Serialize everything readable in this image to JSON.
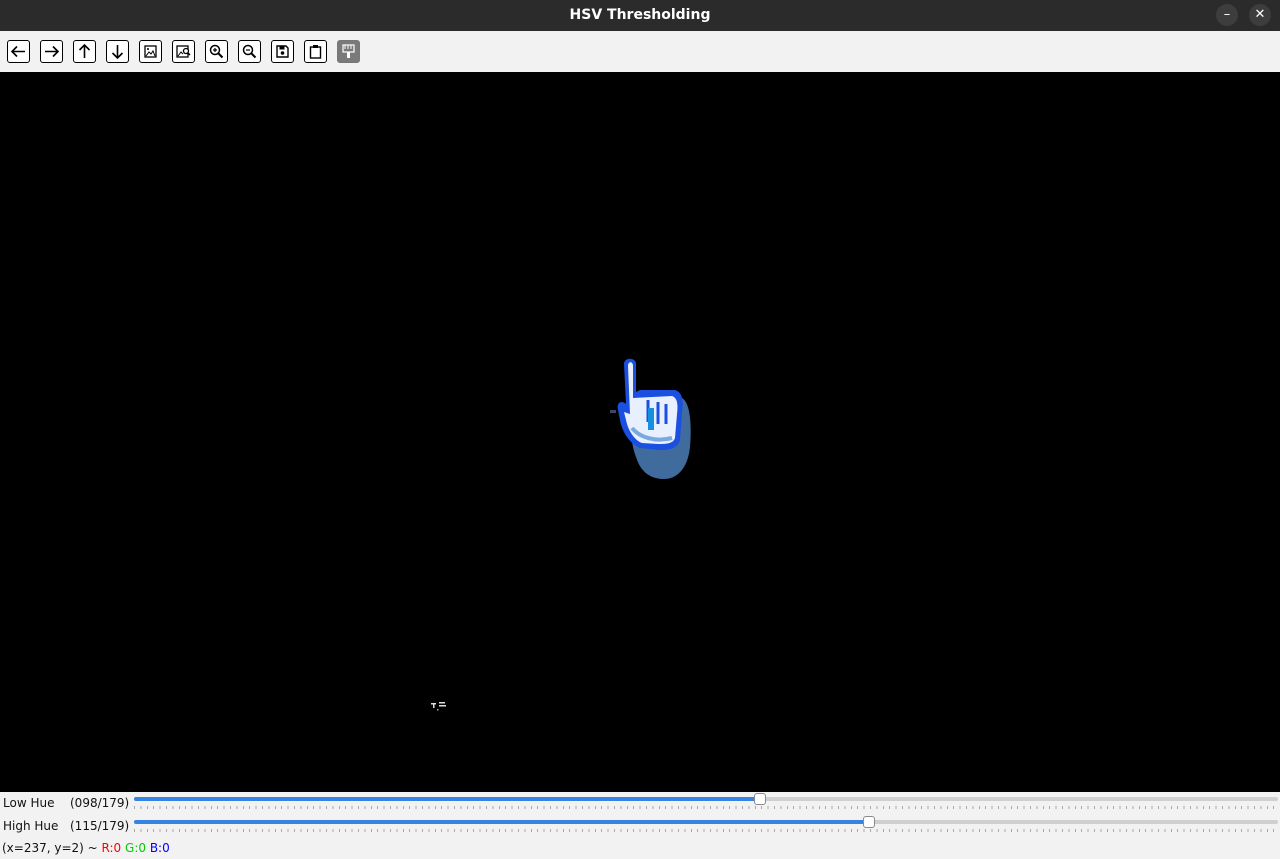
{
  "window": {
    "title": "HSV Thresholding",
    "minimize_label": "–",
    "close_label": "✕"
  },
  "toolbar": {
    "buttons": [
      {
        "icon": "arrow-left-icon",
        "name": "pan-left-button"
      },
      {
        "icon": "arrow-right-icon",
        "name": "pan-right-button"
      },
      {
        "icon": "arrow-up-icon",
        "name": "pan-up-button"
      },
      {
        "icon": "arrow-down-icon",
        "name": "pan-down-button"
      },
      {
        "icon": "image-icon",
        "name": "zoom-original-button"
      },
      {
        "icon": "image-search-icon",
        "name": "zoom-fit-button"
      },
      {
        "icon": "zoom-in-icon",
        "name": "zoom-in-button"
      },
      {
        "icon": "zoom-out-icon",
        "name": "zoom-out-button"
      },
      {
        "icon": "save-icon",
        "name": "save-button"
      },
      {
        "icon": "clipboard-icon",
        "name": "copy-clipboard-button"
      },
      {
        "icon": "properties-icon",
        "name": "properties-button"
      }
    ]
  },
  "trackbars": {
    "low_hue": {
      "label": "Low Hue",
      "value_text": "(098/179)",
      "value": 98,
      "max": 179
    },
    "high_hue": {
      "label": "High Hue",
      "value_text": "(115/179)",
      "value": 115,
      "max": 179
    }
  },
  "status": {
    "coords": "(x=237, y=2) ~ ",
    "r": "R:0",
    "g": "G:0",
    "b": "B:0"
  },
  "colors": {
    "accent": "#3584e4",
    "titlebar": "#2b2b2b",
    "canvas": "#000000"
  }
}
